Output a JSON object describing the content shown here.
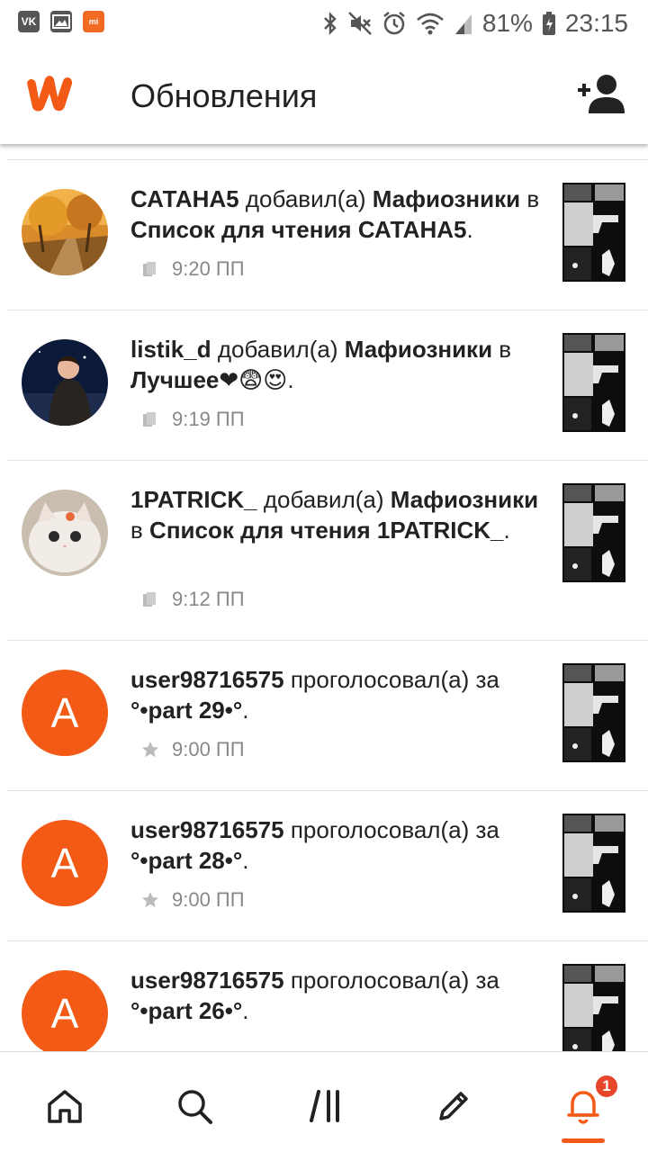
{
  "status_bar": {
    "battery": "81%",
    "time": "23:15",
    "left_icons": [
      "vk-icon",
      "gallery-icon",
      "mi-icon"
    ],
    "vk_label": "VK",
    "mi_label": "mi"
  },
  "header": {
    "title": "Обновления",
    "logo_icon": "wattpad-logo-icon",
    "action_icon": "add-friend-icon"
  },
  "colors": {
    "accent": "#f35a16",
    "badge": "#e8462a",
    "text": "#222222",
    "meta": "#888888"
  },
  "feed": [
    {
      "avatar": "image",
      "user": "САТАНА5",
      "action": "добавил(а)",
      "story": "Мафиозники",
      "connector": "в",
      "target": "Список для чтения САТАНА5",
      "tail": ".",
      "meta_icon": "reading-list-icon",
      "time": "9:20 ПП"
    },
    {
      "avatar": "image",
      "user": "listik_d",
      "action": "добавил(а)",
      "story": "Мафиозники",
      "connector": "в",
      "target": "Лучшее❤😨😍",
      "tail": ".",
      "meta_icon": "reading-list-icon",
      "time": "9:19 ПП"
    },
    {
      "avatar": "image",
      "user": "1PATRICK_",
      "action": "добавил(а)",
      "story": "Мафиозники",
      "connector": "в",
      "target": "Список для чтения 1PATRICK_",
      "tail": ".",
      "meta_icon": "reading-list-icon",
      "time": "9:12 ПП"
    },
    {
      "avatar": "letter",
      "letter": "A",
      "user": "user98716575",
      "action": "проголосовал(а) за",
      "story": "°•part 29•°",
      "tail": ".",
      "meta_icon": "star-icon",
      "time": "9:00 ПП"
    },
    {
      "avatar": "letter",
      "letter": "A",
      "user": "user98716575",
      "action": "проголосовал(а) за",
      "story": "°•part 28•°",
      "tail": ".",
      "meta_icon": "star-icon",
      "time": "9:00 ПП"
    },
    {
      "avatar": "letter",
      "letter": "A",
      "user": "user98716575",
      "action": "проголосовал(а) за",
      "story": "°•part 26•°",
      "tail": ".",
      "meta_icon": "star-icon",
      "time": ""
    }
  ],
  "bottom_nav": {
    "items": [
      "home-icon",
      "search-icon",
      "library-icon",
      "write-icon",
      "notifications-icon"
    ],
    "active": "notifications-icon",
    "notification_count": "1"
  }
}
